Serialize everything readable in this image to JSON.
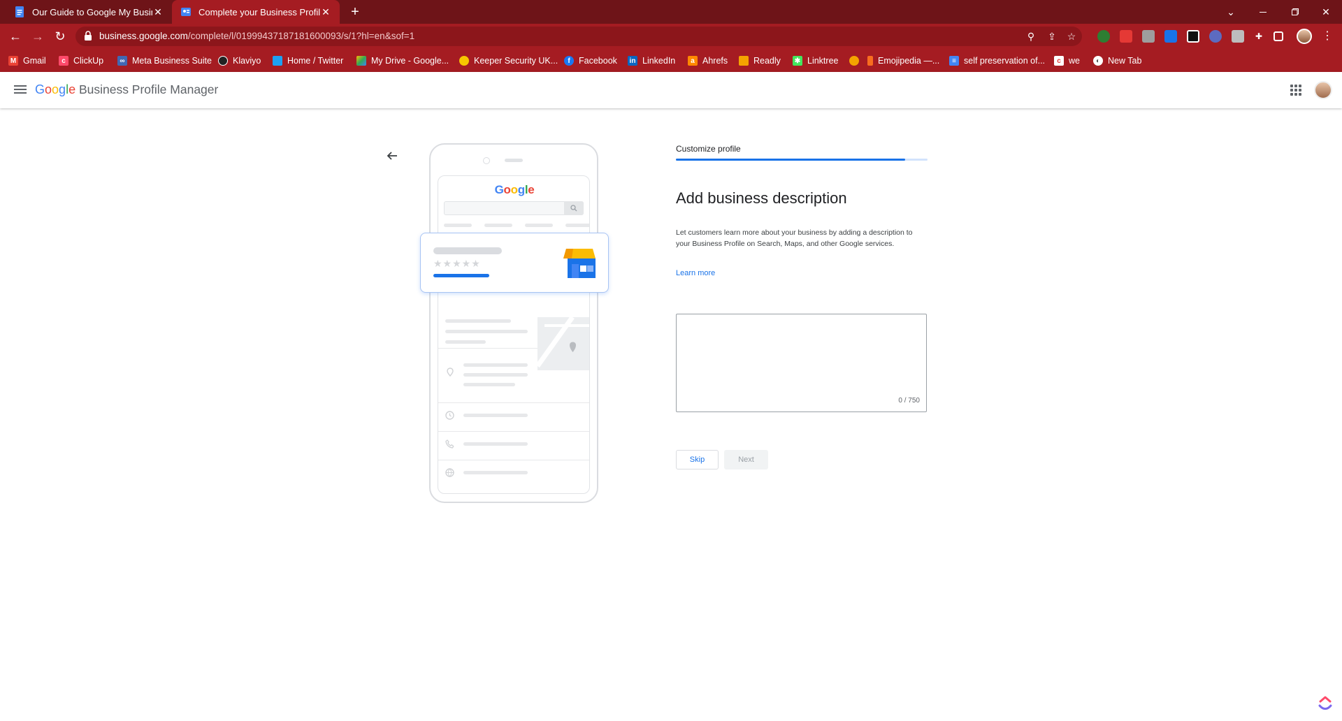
{
  "browser": {
    "tabs": [
      {
        "title": "Our Guide to Google My Business",
        "active": false,
        "close": "✕"
      },
      {
        "title": "Complete your Business Profile",
        "active": true,
        "close": "✕"
      }
    ],
    "new_tab": "+",
    "url_host": "business.google.com",
    "url_path": "/complete/l/01999437187181600093/s/1?hl=en&sof=1",
    "bookmarks": [
      {
        "label": "Gmail",
        "icon": "gmail-icon",
        "color": "#ea4335"
      },
      {
        "label": "ClickUp",
        "icon": "clickup-icon",
        "color": "#ff4a6a"
      },
      {
        "label": "Meta Business Suite",
        "icon": "meta-icon",
        "color": "#4267b2"
      },
      {
        "label": "Klaviyo",
        "icon": "klaviyo-icon",
        "color": "#222222"
      },
      {
        "label": "Home / Twitter",
        "icon": "twitter-icon",
        "color": "#1da1f2"
      },
      {
        "label": "My Drive - Google...",
        "icon": "drive-icon",
        "color": "#34a853"
      },
      {
        "label": "Keeper Security UK...",
        "icon": "keeper-icon",
        "color": "#f7c600"
      },
      {
        "label": "Facebook",
        "icon": "facebook-icon",
        "color": "#1877f2"
      },
      {
        "label": "LinkedIn",
        "icon": "linkedin-icon",
        "color": "#0a66c2"
      },
      {
        "label": "Ahrefs",
        "icon": "ahrefs-icon",
        "color": "#ff8800"
      },
      {
        "label": "Readly",
        "icon": "readly-icon",
        "color": "#f4a300"
      },
      {
        "label": "Linktree",
        "icon": "linktree-icon",
        "color": "#43e55e"
      },
      {
        "label": "",
        "icon": "bookmark-favicon-icon",
        "color": "#f4a300"
      },
      {
        "label": "Emojipedia —...",
        "icon": "emojipedia-icon",
        "color": "#f86d1f"
      },
      {
        "label": "self preservation of...",
        "icon": "docs-icon",
        "color": "#4285f4"
      },
      {
        "label": "we",
        "icon": "we-icon",
        "color": "#e53935"
      },
      {
        "label": "New Tab",
        "icon": "chrome-icon",
        "color": "#ffffff"
      }
    ]
  },
  "app": {
    "title_brand": "Google",
    "title_rest": " Business Profile Manager"
  },
  "illustration": {
    "logo": "Google",
    "stars": "★★★★★"
  },
  "step": {
    "label": "Customize profile",
    "progress": 0.91
  },
  "main": {
    "title": "Add business description",
    "description": "Let customers learn more about your business by adding a description to your Business Profile on Search, Maps, and other Google services.",
    "learn_more": "Learn more",
    "textarea_value": "",
    "counter": "0 / 750",
    "skip_label": "Skip",
    "next_label": "Next"
  },
  "colors": {
    "tab_strip": "#6e1418",
    "toolbar": "#a51c22",
    "accent": "#1a73e8"
  }
}
